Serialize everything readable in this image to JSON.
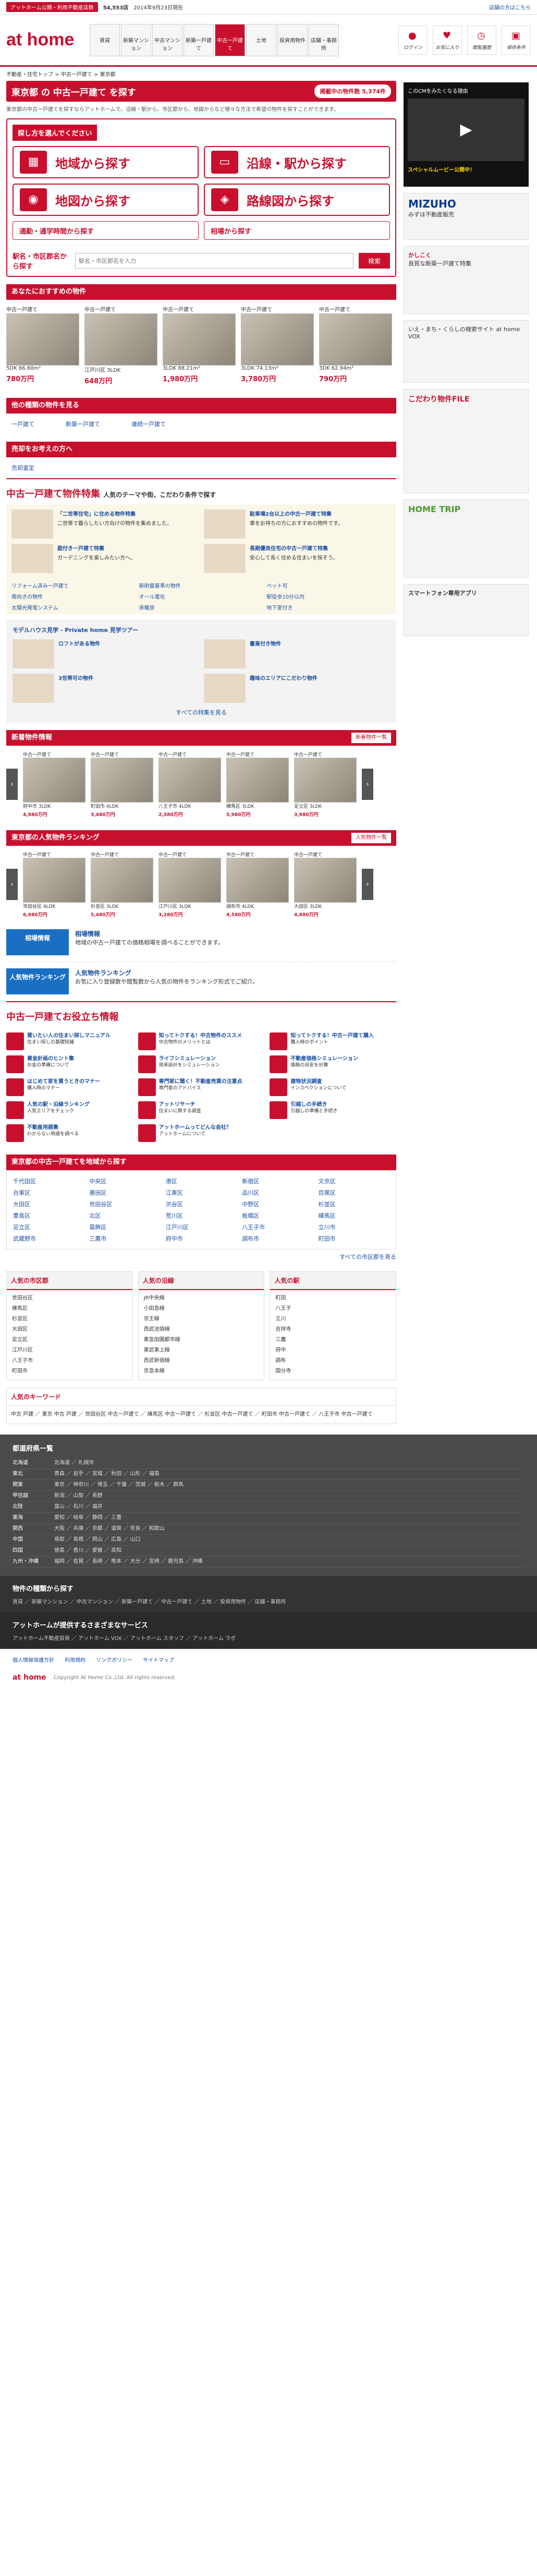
{
  "topbar": {
    "pill1": "アットホーム公開・利用不動産店数",
    "count1": "54,553店",
    "date": "2014年9月23日現在",
    "links": "店舗の方はこちら"
  },
  "header": {
    "logo": "at home",
    "nav": [
      "賃貸",
      "新築マンション",
      "中古マンション",
      "新築一戸建て",
      "中古一戸建て",
      "土地",
      "投資用物件",
      "店舗・事務所"
    ],
    "right": [
      "ログイン",
      "お気に入り",
      "閲覧履歴",
      "保存条件"
    ]
  },
  "crumb": "不動産・住宅トップ > 中古一戸建て > 東京都",
  "title": {
    "text": "東京都 の 中古一戸建て を探す",
    "count_label": "掲載中の物件数",
    "count": "5,374件"
  },
  "desc": "東京都の中古一戸建てを探すならアットホームで。沿線・駅から、市区郡から、地図からなど様々な方法で希望の物件を探すことができます。",
  "search": {
    "head": "探し方を選んでください",
    "area": "地域から探す",
    "line": "沿線・駅から探す",
    "map": "地図から探す",
    "route": "路線図から探す",
    "commute": "通勤・通学時間から探す",
    "price": "相場から探す",
    "kw_label": "駅名・市区郡名から探す",
    "kw_placeholder": "駅名・市区郡名を入力",
    "kw_btn": "検索"
  },
  "recs": {
    "head": "あなたにおすすめの物件",
    "items": [
      {
        "label": "中古一戸建て",
        "spec": "5DK 66.60m²",
        "price": "780万円"
      },
      {
        "label": "中古一戸建て",
        "spec": "江戸川区 3LDK",
        "price": "648万円"
      },
      {
        "label": "中古一戸建て",
        "spec": "3LDK 88.21m²",
        "price": "1,980万円"
      },
      {
        "label": "中古一戸建て",
        "spec": "3LDK 74.13m²",
        "price": "3,780万円"
      },
      {
        "label": "中古一戸建て",
        "spec": "3DK 62.94m²",
        "price": "790万円"
      }
    ]
  },
  "other": {
    "head": "他の種類の物件を見る",
    "links": [
      "一戸建て",
      "新築一戸建て",
      "連続一戸建て"
    ]
  },
  "rec2": {
    "head": "売却をお考えの方へ",
    "link": "売却査定"
  },
  "feature": {
    "head": "中古一戸建て物件特集",
    "sub": "人気のテーマや街、こだわり条件で探す",
    "more": "中古一戸建て物件特集一覧へ",
    "items": [
      {
        "t": "「二世帯住宅」に住める物件特集",
        "d": "二世帯で暮らしたい方向けの物件を集めました。"
      },
      {
        "t": "駐車場2台以上の中古一戸建て特集",
        "d": "車をお持ちの方におすすめの物件です。"
      },
      {
        "t": "庭付き一戸建て特集",
        "d": "ガーデニングを楽しみたい方へ。"
      },
      {
        "t": "長期優良住宅の中古一戸建て特集",
        "d": "安心して長く住める住まいを探そう。"
      }
    ],
    "tags": [
      "リフォーム済み一戸建て",
      "新耐震基準の物件",
      "ペット可",
      "南向きの物件",
      "オール電化",
      "駅徒歩10分以内",
      "太陽光発電システム",
      "床暖房",
      "地下室付き"
    ]
  },
  "kinds": {
    "title": "モデルハウス見学 - Private home 見学ツアー",
    "items": [
      "ロフトがある物件",
      "書斎付き物件",
      "3世帯可の物件",
      "趣味のエリアにこだわり物件"
    ],
    "more": "すべての特集を見る"
  },
  "newlist": {
    "head": "新着物件情報",
    "more": "新着物件一覧",
    "items": [
      {
        "l": "中古一戸建て",
        "s": "府中市 3LDK",
        "p": "4,980万円"
      },
      {
        "l": "中古一戸建て",
        "s": "町田市 4LDK",
        "p": "3,480万円"
      },
      {
        "l": "中古一戸建て",
        "s": "八王子市 4LDK",
        "p": "2,380万円"
      },
      {
        "l": "中古一戸建て",
        "s": "練馬区 3LDK",
        "p": "5,980万円"
      },
      {
        "l": "中古一戸建て",
        "s": "足立区 3LDK",
        "p": "3,980万円"
      }
    ]
  },
  "ranking": {
    "head": "東京都の人気物件ランキング",
    "more": "人気物件一覧",
    "items": [
      {
        "l": "中古一戸建て",
        "s": "世田谷区 4LDK",
        "p": "6,980万円"
      },
      {
        "l": "中古一戸建て",
        "s": "杉並区 3LDK",
        "p": "5,480万円"
      },
      {
        "l": "中古一戸建て",
        "s": "江戸川区 3LDK",
        "p": "3,280万円"
      },
      {
        "l": "中古一戸建て",
        "s": "調布市 4LDK",
        "p": "4,580万円"
      },
      {
        "l": "中古一戸建て",
        "s": "大田区 3LDK",
        "p": "4,880万円"
      }
    ]
  },
  "promos": [
    {
      "bn": "相場情報",
      "t": "相場情報",
      "d": "地域の中古一戸建ての価格相場を調べることができます。"
    },
    {
      "bn": "人気物件ランキング",
      "t": "人気物件ランキング",
      "d": "お気に入り登録数や閲覧数から人気の物件をランキング形式でご紹介。"
    }
  ],
  "help": {
    "head": "中古一戸建てお役立ち情報",
    "items": [
      {
        "t": "買いたい人の住まい探しマニュアル",
        "d": "住まい探しの基礎知識"
      },
      {
        "t": "知ってトクする！中古物件のススメ",
        "d": "中古物件のメリットとは"
      },
      {
        "t": "知ってトクする！中古一戸建て購入",
        "d": "購入時のポイント"
      },
      {
        "t": "資金計画のヒント集",
        "d": "お金の準備について"
      },
      {
        "t": "ライフシミュレーション",
        "d": "将来設計をシミュレーション"
      },
      {
        "t": "不動産価格シミュレーション",
        "d": "価格の目安を計算"
      },
      {
        "t": "はじめて家を買うときのマナー",
        "d": "購入時のマナー"
      },
      {
        "t": "専門家に聞く！不動産売買の注意点",
        "d": "専門家のアドバイス"
      },
      {
        "t": "建物状況調査",
        "d": "インスペクションについて"
      },
      {
        "t": "人気の駅・沿線ランキング",
        "d": "人気エリアをチェック"
      },
      {
        "t": "アットリサーチ",
        "d": "住まいに関する調査"
      },
      {
        "t": "引越しの手続き",
        "d": "引越しの準備と手続き"
      },
      {
        "t": "不動産用語集",
        "d": "わからない用語を調べる"
      },
      {
        "t": "アットホームってどんな会社？",
        "d": "アットホームについて"
      }
    ]
  },
  "areas": {
    "head": "東京都の中古一戸建てを地域から探す",
    "list": [
      "千代田区",
      "中央区",
      "港区",
      "新宿区",
      "文京区",
      "台東区",
      "墨田区",
      "江東区",
      "品川区",
      "目黒区",
      "大田区",
      "世田谷区",
      "渋谷区",
      "中野区",
      "杉並区",
      "豊島区",
      "北区",
      "荒川区",
      "板橋区",
      "練馬区",
      "足立区",
      "葛飾区",
      "江戸川区",
      "八王子市",
      "立川市",
      "武蔵野市",
      "三鷹市",
      "府中市",
      "調布市",
      "町田市"
    ],
    "more": "すべての市区郡を見る"
  },
  "pop": [
    {
      "h": "人気の市区郡",
      "items": [
        "世田谷区",
        "練馬区",
        "杉並区",
        "大田区",
        "足立区",
        "江戸川区",
        "八王子市",
        "町田市"
      ]
    },
    {
      "h": "人気の沿線",
      "items": [
        "JR中央線",
        "小田急線",
        "京王線",
        "西武池袋線",
        "東急田園都市線",
        "東武東上線",
        "西武新宿線",
        "京急本線"
      ]
    },
    {
      "h": "人気の駅",
      "items": [
        "町田",
        "八王子",
        "立川",
        "吉祥寺",
        "三鷹",
        "府中",
        "調布",
        "国分寺"
      ]
    }
  ],
  "keywords": {
    "h": "人気のキーワード",
    "text": "中古 戸建 ／ 東京 中古 戸建 ／ 世田谷区 中古一戸建て ／ 練馬区 中古一戸建て ／ 杉並区 中古一戸建て ／ 町田市 中古一戸建て ／ 八王子市 中古一戸建て"
  },
  "side": {
    "ad1": "このCMをみたくなる理由",
    "ad1b": "スペシャルムービー公開中！",
    "ad2": "MIZUHO",
    "ad2b": "みずほ不動産販売",
    "ad3": "かしこく",
    "ad3b": "良質な新築一戸建て特集",
    "ad4": "いえ・まち・くらしの検索サイト at home VOX",
    "ad5": "こだわり物件FILE",
    "ad6": "HOME TRIP",
    "ad7": "スマートフォン専用アプリ"
  },
  "footer": {
    "h": "都道府県一覧",
    "rows": [
      {
        "r": "北海道",
        "v": "北海道 ／ 札幌市"
      },
      {
        "r": "東北",
        "v": "青森 ／ 岩手 ／ 宮城 ／ 秋田 ／ 山形 ／ 福島"
      },
      {
        "r": "関東",
        "v": "東京 ／ 神奈川 ／ 埼玉 ／ 千葉 ／ 茨城 ／ 栃木 ／ 群馬"
      },
      {
        "r": "甲信越",
        "v": "新潟 ／ 山梨 ／ 長野"
      },
      {
        "r": "北陸",
        "v": "富山 ／ 石川 ／ 福井"
      },
      {
        "r": "東海",
        "v": "愛知 ／ 岐阜 ／ 静岡 ／ 三重"
      },
      {
        "r": "関西",
        "v": "大阪 ／ 兵庫 ／ 京都 ／ 滋賀 ／ 奈良 ／ 和歌山"
      },
      {
        "r": "中国",
        "v": "鳥取 ／ 島根 ／ 岡山 ／ 広島 ／ 山口"
      },
      {
        "r": "四国",
        "v": "徳島 ／ 香川 ／ 愛媛 ／ 高知"
      },
      {
        "r": "九州・沖縄",
        "v": "福岡 ／ 佐賀 ／ 長崎 ／ 熊本 ／ 大分 ／ 宮崎 ／ 鹿児島 ／ 沖縄"
      }
    ],
    "h2": "物件の種類から探す",
    "t2": "賃貸 ／ 新築マンション ／ 中古マンション ／ 新築一戸建て ／ 中古一戸建て ／ 土地 ／ 投資用物件 ／ 店舗・事務所",
    "h3": "アットホームが提供するさまざまなサービス",
    "t3": "アットホーム不動産投資 ／ アットホーム VOX ／ アットホーム スタッフ ／ アットホーム ラボ"
  },
  "bottom": [
    "個人情報保護方針",
    "利用規約",
    "リンクポリシー",
    "サイトマップ"
  ],
  "copyright": "Copyright At Home Co.,Ltd. All rights reserved."
}
